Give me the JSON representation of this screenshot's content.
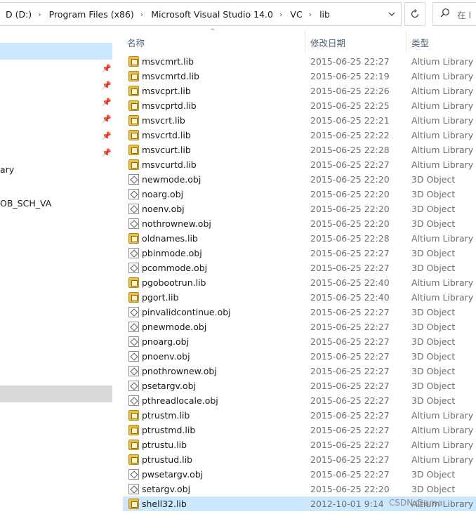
{
  "address_bar": {
    "crumbs": [
      "D (D:)",
      "Program Files (x86)",
      "Microsoft Visual Studio 14.0",
      "VC",
      "lib"
    ],
    "dropdown_icon": "chevron-down-icon",
    "refresh_icon": "refresh-icon"
  },
  "search": {
    "placeholder": "在 l",
    "icon": "search-icon"
  },
  "nav_pane": {
    "partial_items": [
      "ary",
      "OB_SCH_VA"
    ]
  },
  "columns": {
    "name": "名称",
    "date": "修改日期",
    "type": "类型"
  },
  "files": [
    {
      "name": "msvcmrt.lib",
      "date": "2015-06-25 22:27",
      "type": "Altium Library",
      "icon": "lib-file-icon"
    },
    {
      "name": "msvcmrtd.lib",
      "date": "2015-06-25 22:19",
      "type": "Altium Library",
      "icon": "lib-file-icon"
    },
    {
      "name": "msvcprt.lib",
      "date": "2015-06-25 22:26",
      "type": "Altium Library",
      "icon": "lib-file-icon"
    },
    {
      "name": "msvcprtd.lib",
      "date": "2015-06-25 22:25",
      "type": "Altium Library",
      "icon": "lib-file-icon"
    },
    {
      "name": "msvcrt.lib",
      "date": "2015-06-25 22:21",
      "type": "Altium Library",
      "icon": "lib-file-icon"
    },
    {
      "name": "msvcrtd.lib",
      "date": "2015-06-25 22:22",
      "type": "Altium Library",
      "icon": "lib-file-icon"
    },
    {
      "name": "msvcurt.lib",
      "date": "2015-06-25 22:28",
      "type": "Altium Library",
      "icon": "lib-file-icon"
    },
    {
      "name": "msvcurtd.lib",
      "date": "2015-06-25 22:27",
      "type": "Altium Library",
      "icon": "lib-file-icon"
    },
    {
      "name": "newmode.obj",
      "date": "2015-06-25 22:20",
      "type": "3D Object",
      "icon": "obj-file-icon"
    },
    {
      "name": "noarg.obj",
      "date": "2015-06-25 22:20",
      "type": "3D Object",
      "icon": "obj-file-icon"
    },
    {
      "name": "noenv.obj",
      "date": "2015-06-25 22:20",
      "type": "3D Object",
      "icon": "obj-file-icon"
    },
    {
      "name": "nothrownew.obj",
      "date": "2015-06-25 22:20",
      "type": "3D Object",
      "icon": "obj-file-icon"
    },
    {
      "name": "oldnames.lib",
      "date": "2015-06-25 22:28",
      "type": "Altium Library",
      "icon": "lib-file-icon"
    },
    {
      "name": "pbinmode.obj",
      "date": "2015-06-25 22:27",
      "type": "3D Object",
      "icon": "obj-file-icon"
    },
    {
      "name": "pcommode.obj",
      "date": "2015-06-25 22:27",
      "type": "3D Object",
      "icon": "obj-file-icon"
    },
    {
      "name": "pgobootrun.lib",
      "date": "2015-06-25 22:40",
      "type": "Altium Library",
      "icon": "lib-file-icon"
    },
    {
      "name": "pgort.lib",
      "date": "2015-06-25 22:40",
      "type": "Altium Library",
      "icon": "lib-file-icon"
    },
    {
      "name": "pinvalidcontinue.obj",
      "date": "2015-06-25 22:27",
      "type": "3D Object",
      "icon": "obj-file-icon"
    },
    {
      "name": "pnewmode.obj",
      "date": "2015-06-25 22:27",
      "type": "3D Object",
      "icon": "obj-file-icon"
    },
    {
      "name": "pnoarg.obj",
      "date": "2015-06-25 22:27",
      "type": "3D Object",
      "icon": "obj-file-icon"
    },
    {
      "name": "pnoenv.obj",
      "date": "2015-06-25 22:27",
      "type": "3D Object",
      "icon": "obj-file-icon"
    },
    {
      "name": "pnothrownew.obj",
      "date": "2015-06-25 22:27",
      "type": "3D Object",
      "icon": "obj-file-icon"
    },
    {
      "name": "psetargv.obj",
      "date": "2015-06-25 22:27",
      "type": "3D Object",
      "icon": "obj-file-icon"
    },
    {
      "name": "pthreadlocale.obj",
      "date": "2015-06-25 22:27",
      "type": "3D Object",
      "icon": "obj-file-icon"
    },
    {
      "name": "ptrustm.lib",
      "date": "2015-06-25 22:27",
      "type": "Altium Library",
      "icon": "lib-file-icon"
    },
    {
      "name": "ptrustmd.lib",
      "date": "2015-06-25 22:27",
      "type": "Altium Library",
      "icon": "lib-file-icon"
    },
    {
      "name": "ptrustu.lib",
      "date": "2015-06-25 22:27",
      "type": "Altium Library",
      "icon": "lib-file-icon"
    },
    {
      "name": "ptrustud.lib",
      "date": "2015-06-25 22:27",
      "type": "Altium Library",
      "icon": "lib-file-icon"
    },
    {
      "name": "pwsetargv.obj",
      "date": "2015-06-25 22:27",
      "type": "3D Object",
      "icon": "obj-file-icon"
    },
    {
      "name": "setargv.obj",
      "date": "2015-06-25 22:20",
      "type": "3D Object",
      "icon": "obj-file-icon"
    },
    {
      "name": "shell32.lib",
      "date": "2012-10-01 9:14",
      "type": "Altium Library",
      "icon": "lib-file-icon",
      "selected": true
    }
  ],
  "watermark": "CSDN @ama",
  "colors": {
    "selection": "#cce8ff",
    "header_text": "#4c607a",
    "secondary_text": "#6d6d6d"
  }
}
